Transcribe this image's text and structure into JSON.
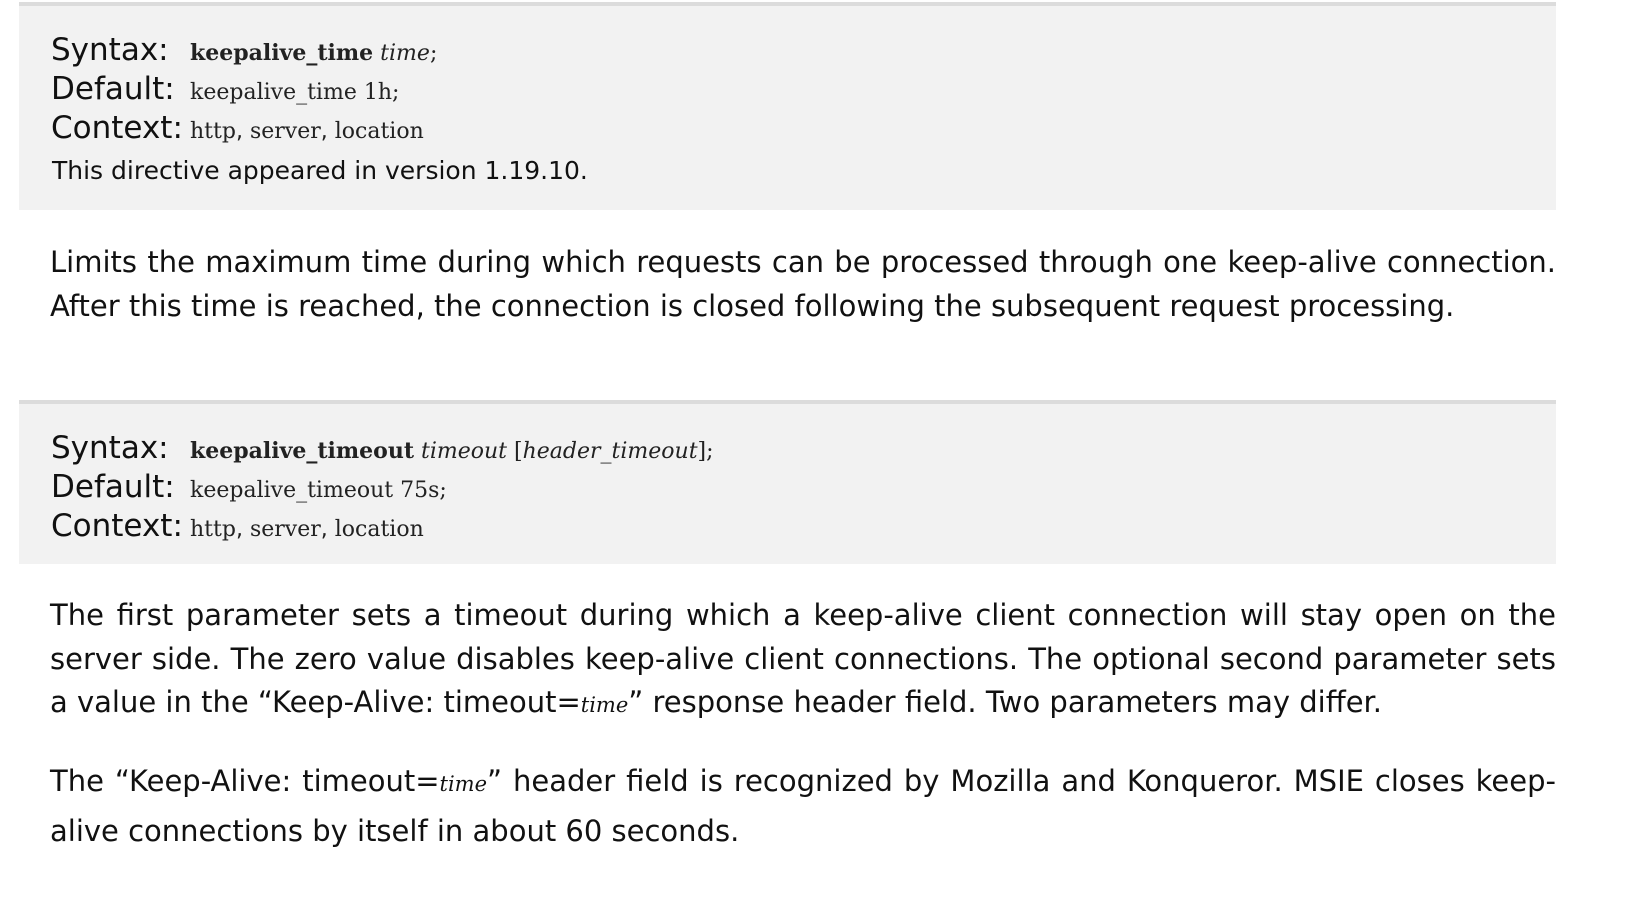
{
  "directives": [
    {
      "syntax_label": "Syntax:",
      "syntax_name": "keepalive_time",
      "syntax_param": "time",
      "syntax_end": ";",
      "default_label": "Default:",
      "default_value": "keepalive_time 1h;",
      "context_label": "Context:",
      "context_1": "http",
      "context_2": "server",
      "context_3": "location",
      "context_sep": ",",
      "since": "This directive appeared in version 1.19.10."
    },
    {
      "syntax_label": "Syntax:",
      "syntax_name": "keepalive_timeout",
      "syntax_param": "timeout",
      "syntax_open": "[",
      "syntax_param2": "header_timeout",
      "syntax_end": "];",
      "default_label": "Default:",
      "default_value": "keepalive_timeout 75s;",
      "context_label": "Context:",
      "context_1": "http",
      "context_2": "server",
      "context_3": "location",
      "context_sep": ","
    }
  ],
  "paragraphs": {
    "p1": "Limits the maximum time during which requests can be processed through one keep-alive connection. After this time is reached, the connection is closed following the subsequent request processing.",
    "p2_before": "The first parameter sets a timeout during which a keep-alive client connection will stay open on the server side. The zero value disables keep-alive client connections. The optional second parameter sets a value in the  “Keep-Alive: timeout=",
    "p2_code": "time",
    "p2_after": "”  response header field. Two parameters may differ.",
    "p3_before": "The  “Keep-Alive: timeout=",
    "p3_code": "time",
    "p3_after": "”  header field is recognized by Mozilla and Konqueror. MSIE closes keep-alive connections by itself in about 60 seconds."
  }
}
